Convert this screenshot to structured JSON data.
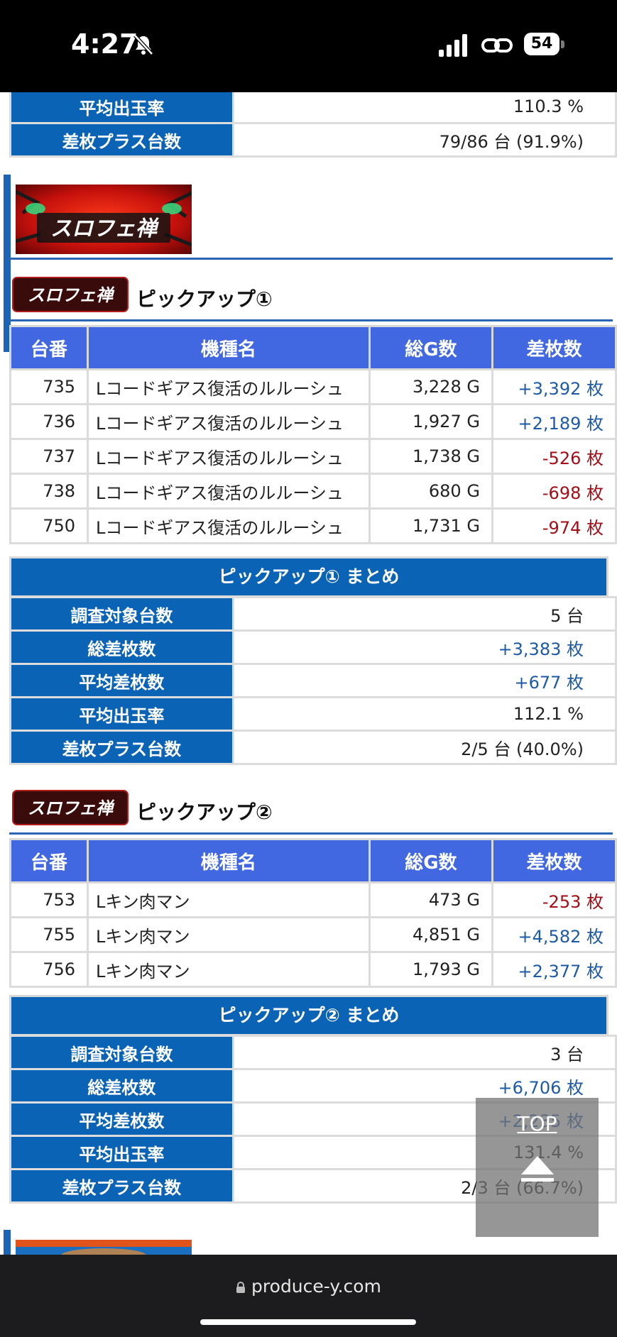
{
  "status": {
    "time": "4:27",
    "battery": "54"
  },
  "prev_summary": [
    {
      "label": "平均出玉率",
      "value": "110.3 %"
    },
    {
      "label": "差枚プラス台数",
      "value": "79/86 台 (91.9%)"
    }
  ],
  "banner": {
    "alt": "スロフェ禅"
  },
  "pickup1": {
    "logo_text": "スロフェ禅",
    "title": "ピックアップ①",
    "headers": [
      "台番",
      "機種名",
      "総G数",
      "差枚数"
    ],
    "rows": [
      {
        "no": "735",
        "model": "Lコードギアス復活のルルーシュ",
        "games": "3,228 G",
        "diff": "+3,392 枚",
        "sign": "pos"
      },
      {
        "no": "736",
        "model": "Lコードギアス復活のルルーシュ",
        "games": "1,927 G",
        "diff": "+2,189 枚",
        "sign": "pos"
      },
      {
        "no": "737",
        "model": "Lコードギアス復活のルルーシュ",
        "games": "1,738 G",
        "diff": "-526 枚",
        "sign": "neg"
      },
      {
        "no": "738",
        "model": "Lコードギアス復活のルルーシュ",
        "games": "680 G",
        "diff": "-698 枚",
        "sign": "neg"
      },
      {
        "no": "750",
        "model": "Lコードギアス復活のルルーシュ",
        "games": "1,731 G",
        "diff": "-974 枚",
        "sign": "neg"
      }
    ],
    "summary_title": "ピックアップ① まとめ",
    "summary": [
      {
        "label": "調査対象台数",
        "value": "5 台",
        "sign": ""
      },
      {
        "label": "総差枚数",
        "value": "+3,383 枚",
        "sign": "pos"
      },
      {
        "label": "平均差枚数",
        "value": "+677 枚",
        "sign": "pos"
      },
      {
        "label": "平均出玉率",
        "value": "112.1 %",
        "sign": ""
      },
      {
        "label": "差枚プラス台数",
        "value": "2/5 台 (40.0%)",
        "sign": ""
      }
    ]
  },
  "pickup2": {
    "logo_text": "スロフェ禅",
    "title": "ピックアップ②",
    "headers": [
      "台番",
      "機種名",
      "総G数",
      "差枚数"
    ],
    "rows": [
      {
        "no": "753",
        "model": "Lキン肉マン",
        "games": "473 G",
        "diff": "-253 枚",
        "sign": "neg"
      },
      {
        "no": "755",
        "model": "Lキン肉マン",
        "games": "4,851 G",
        "diff": "+4,582 枚",
        "sign": "pos"
      },
      {
        "no": "756",
        "model": "Lキン肉マン",
        "games": "1,793 G",
        "diff": "+2,377 枚",
        "sign": "pos"
      }
    ],
    "summary_title": "ピックアップ② まとめ",
    "summary": [
      {
        "label": "調査対象台数",
        "value": "3 台",
        "sign": ""
      },
      {
        "label": "総差枚数",
        "value": "+6,706 枚",
        "sign": "pos"
      },
      {
        "label": "平均差枚数",
        "value": "+2,235 枚",
        "sign": "pos"
      },
      {
        "label": "平均出玉率",
        "value": "131.4 %",
        "sign": ""
      },
      {
        "label": "差枚プラス台数",
        "value": "2/3 台 (66.7%)",
        "sign": ""
      }
    ]
  },
  "top_button": {
    "label": "TOP"
  },
  "address_bar": {
    "url": "produce-y.com"
  },
  "colors": {
    "header_blue": "#0b63b5",
    "table_header": "#4168e1",
    "positive": "#1d5aa8",
    "negative": "#a40e16"
  }
}
